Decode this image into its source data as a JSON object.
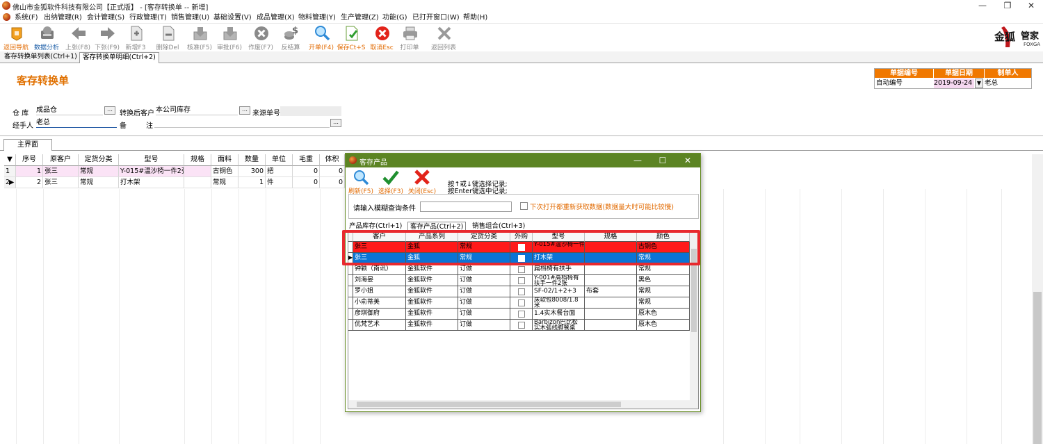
{
  "window": {
    "title": "佛山市金狐软件科技有限公司【正式版】 - [客存转换单 -- 新增]",
    "minimize": "—",
    "restore": "❐",
    "close": "✕",
    "mdi_minimize": "_",
    "mdi_restore": "▭",
    "mdi_close": "×"
  },
  "menu": [
    "系统(F)",
    "出纳管理(R)",
    "会计管理(S)",
    "行政管理(T)",
    "销售管理(U)",
    "基础设置(V)",
    "成品管理(X)",
    "物料管理(Y)",
    "生产管理(Z)",
    "功能(G)",
    "已打开窗口(W)",
    "帮助(H)"
  ],
  "toolbar": [
    {
      "label": "返回导航",
      "state": "on",
      "icon": "home-icon"
    },
    {
      "label": "数据分析",
      "state": "blue",
      "icon": "analysis-icon"
    },
    {
      "label": "上张(F8)",
      "state": "off",
      "icon": "arrow-left-icon"
    },
    {
      "label": "下张(F9)",
      "state": "off",
      "icon": "arrow-right-icon"
    },
    {
      "label": "新增F3",
      "state": "off",
      "icon": "new-doc-icon"
    },
    {
      "label": "删除Del",
      "state": "off",
      "icon": "delete-doc-icon"
    },
    {
      "label": "核准(F5)",
      "state": "off",
      "icon": "approve-icon"
    },
    {
      "label": "审批(F6)",
      "state": "off",
      "icon": "review-icon"
    },
    {
      "label": "作废(F7)",
      "state": "off",
      "icon": "void-icon"
    },
    {
      "label": "反结算",
      "state": "off",
      "icon": "reverse-settle-icon"
    },
    {
      "label": "开单(F4)",
      "state": "on",
      "icon": "open-bill-icon"
    },
    {
      "label": "保存Ct+S",
      "state": "on",
      "icon": "save-icon"
    },
    {
      "label": "取消Esc",
      "state": "on",
      "icon": "cancel-icon"
    },
    {
      "label": "打印单",
      "state": "off",
      "icon": "print-icon"
    },
    {
      "label": "返回列表",
      "state": "off",
      "icon": "back-list-icon"
    }
  ],
  "brand": {
    "logo_text": "金狐",
    "logo_sub": "管家",
    "logo_en": "FOXGA"
  },
  "doc_tabs": [
    "客存转换单列表(Ctrl+1)",
    "客存转换单明细(Ctrl+2)"
  ],
  "form": {
    "title": "客存转换单",
    "warehouse_label": "仓  库",
    "warehouse_value": "成品仓",
    "customer_label": "转换后客户",
    "customer_value": "本公司库存",
    "source_label": "来源单号",
    "handler_label": "经手人",
    "handler_value": "老总",
    "remark_label_1": "备",
    "remark_label_2": "注",
    "browse": "…"
  },
  "info_box": {
    "headers": [
      "单据编号",
      "单据日期",
      "制单人"
    ],
    "number": "自动编号",
    "date": "2019-09-24",
    "maker": "老总"
  },
  "main_tab": "主界面",
  "grid": {
    "sort_marker": "▼",
    "headers": [
      "序号",
      "原客户",
      "定货分类",
      "型号",
      "规格",
      "面料",
      "数量",
      "单位",
      "毛重",
      "体积"
    ],
    "rows": [
      {
        "idx": "1",
        "marker": "",
        "cells": [
          "1",
          "张三",
          "常规",
          "Y-015#温沙椅一件2张",
          "",
          "古铜色",
          "300",
          "把",
          "0",
          "0"
        ]
      },
      {
        "idx": "2",
        "marker": "▶",
        "cells": [
          "2",
          "张三",
          "常规",
          "打木架",
          "",
          "常规",
          "1",
          "件",
          "0",
          "0"
        ]
      }
    ]
  },
  "popup": {
    "title": "客存产品",
    "minimize": "—",
    "maximize": "☐",
    "close": "✕",
    "buttons": [
      {
        "label": "刷新(F5)",
        "icon": "refresh-icon"
      },
      {
        "label": "选择(F3)",
        "icon": "checkmark-icon"
      },
      {
        "label": "关闭(Esc)",
        "icon": "close-x-icon"
      }
    ],
    "hint_1": "按↑或↓键选择记录;",
    "hint_2": "按Enter键选中记录;",
    "filter_label": "请输入模糊查询条件",
    "filter_value": "",
    "reload_label": "下次打开都重新获取数据(数据量大时可能比较慢)",
    "tabs": [
      "产品库存(Ctrl+1)",
      "客存产品(Ctrl+2)",
      "销售组合(Ctrl+3)"
    ],
    "headers": [
      "客户",
      "产品系列",
      "定货分类",
      "外购",
      "型号",
      "规格",
      "颜色"
    ],
    "rows": [
      {
        "customer": "张三",
        "series": "金狐",
        "category": "常规",
        "model": "Y-015#温沙椅一件2张",
        "spec": "",
        "color": "古铜色",
        "style": "red"
      },
      {
        "customer": "张三",
        "series": "金狐",
        "category": "常规",
        "model": "打木架",
        "spec": "",
        "color": "常规",
        "style": "blue"
      },
      {
        "customer": "钟颖（南讯）",
        "series": "金狐软件",
        "category": "订做",
        "model": "扁档椅有扶手",
        "spec": "",
        "color": "常规",
        "style": ""
      },
      {
        "customer": "刘海晏",
        "series": "金狐软件",
        "category": "订做",
        "model": "Y-001#高档椅有扶手一件2张",
        "spec": "",
        "color": "黑色",
        "style": ""
      },
      {
        "customer": "罗小姐",
        "series": "金狐软件",
        "category": "订做",
        "model": "SF-02/1+2+3",
        "spec": "布套",
        "color": "常规",
        "style": ""
      },
      {
        "customer": "小俞蒂美",
        "series": "金狐软件",
        "category": "订做",
        "model": "床软包8008/1.8米",
        "spec": "",
        "color": "常规",
        "style": ""
      },
      {
        "customer": "彦琪御府",
        "series": "金狐软件",
        "category": "订做",
        "model": "1.4实木餐台面",
        "spec": "",
        "color": "原木色",
        "style": ""
      },
      {
        "customer": "优梵艺术",
        "series": "金狐软件",
        "category": "订做",
        "model": "Barbizon巴比松实木弧线脚餐桌",
        "spec": "",
        "color": "原木色",
        "style": ""
      }
    ]
  }
}
